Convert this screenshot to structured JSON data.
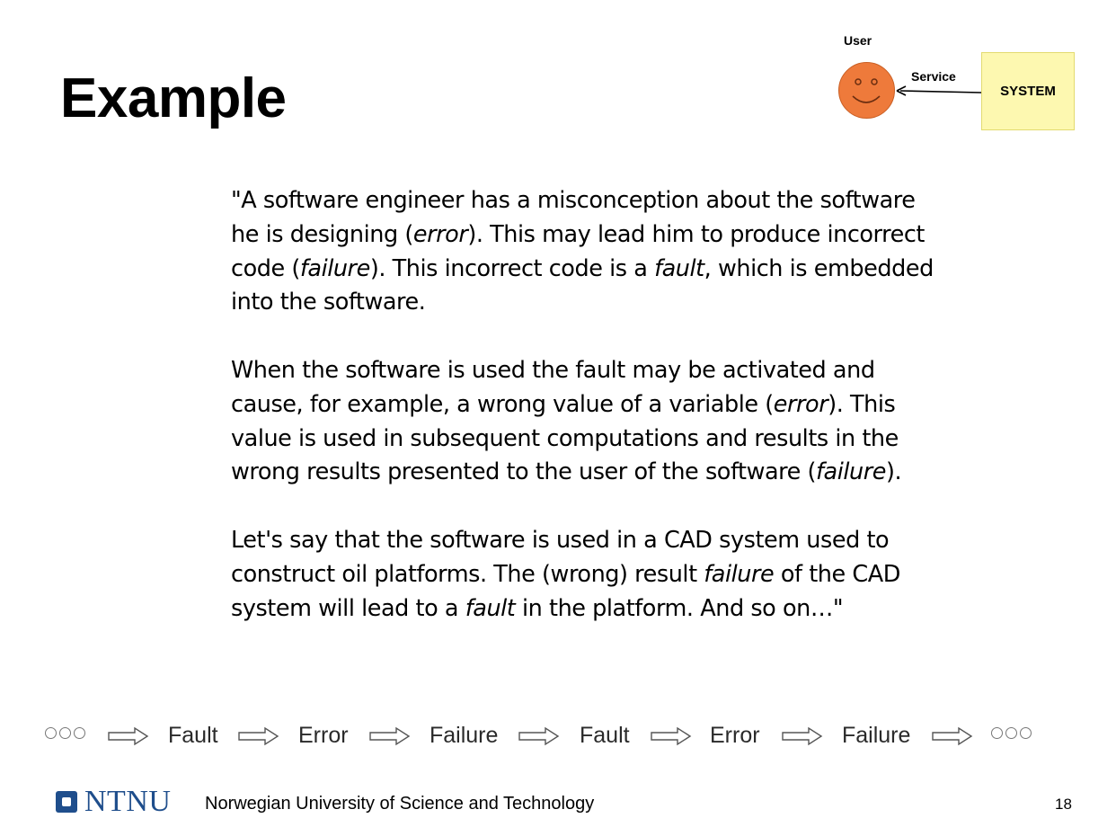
{
  "slide": {
    "title": "Example",
    "page_number": "18"
  },
  "diagram": {
    "user_label": "User",
    "service_label": "Service",
    "system_label": "SYSTEM",
    "colors": {
      "face": "#ee7a3b",
      "system_box": "#fdf8b0"
    }
  },
  "quote": {
    "paragraphs": [
      [
        [
          {
            "t": "\"A software engineer has a misconception about the software"
          }
        ],
        [
          {
            "t": "he is designing ("
          },
          {
            "t": "error",
            "i": true
          },
          {
            "t": "). This may lead him to produce incorrect"
          }
        ],
        [
          {
            "t": "code ("
          },
          {
            "t": "failure",
            "i": true
          },
          {
            "t": "). This incorrect code is a "
          },
          {
            "t": "fault",
            "i": true
          },
          {
            "t": ", which is embedded"
          }
        ],
        [
          {
            "t": "into the software."
          }
        ]
      ],
      [
        [
          {
            "t": "When the software is used the fault may be activated and"
          }
        ],
        [
          {
            "t": "cause, for example, a wrong value of a variable ("
          },
          {
            "t": "error",
            "i": true
          },
          {
            "t": "). This"
          }
        ],
        [
          {
            "t": "value is used in subsequent computations and results in the"
          }
        ],
        [
          {
            "t": "wrong results presented to the user of the software ("
          },
          {
            "t": "failure",
            "i": true
          },
          {
            "t": ")."
          }
        ]
      ],
      [
        [
          {
            "t": "Let's say that the software is used in a CAD system used to"
          }
        ],
        [
          {
            "t": "construct oil platforms. The (wrong) result "
          },
          {
            "t": "failure",
            "i": true
          },
          {
            "t": " of the CAD"
          }
        ],
        [
          {
            "t": "system will lead to a "
          },
          {
            "t": "fault",
            "i": true
          },
          {
            "t": " in the platform. And so on…\""
          }
        ]
      ]
    ]
  },
  "chain": {
    "words": [
      "Fault",
      "Error",
      "Failure",
      "Fault",
      "Error",
      "Failure"
    ]
  },
  "footer": {
    "logo_text": "NTNU",
    "university": "Norwegian University of Science and Technology"
  }
}
